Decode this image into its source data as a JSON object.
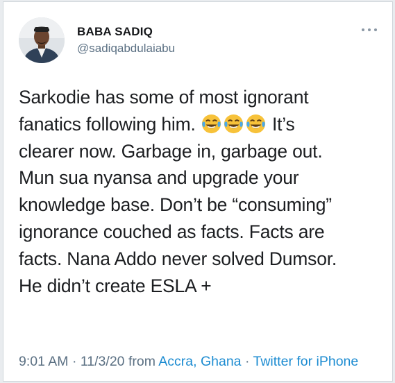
{
  "tweet": {
    "author": {
      "name": "BABA SADIQ",
      "handle": "@sadiqabdulaiabu"
    },
    "body": {
      "line1": "Sarkodie has some of most ignorant",
      "line2_before": "fanatics following him.",
      "line2_after": "It’s",
      "line3": "clearer now. Garbage in, garbage out.",
      "line4": "Mun sua nyansa and upgrade your",
      "line5": "knowledge base. Don’t be “consuming”",
      "line6": "ignorance couched as facts. Facts are",
      "line7": "facts. Nana Addo never solved Dumsor.",
      "line8": "He didn’t create ESLA +",
      "emojis": [
        "face-with-tears-of-joy",
        "face-with-tears-of-joy",
        "face-with-tears-of-joy"
      ]
    },
    "meta": {
      "time": "9:01 AM",
      "separator": "·",
      "date": "11/3/20",
      "from_label": "from",
      "location": "Accra, Ghana",
      "client": "Twitter for iPhone"
    }
  },
  "colors": {
    "name_text": "#141619",
    "secondary_text": "#5b7083",
    "link": "#1b8bd1",
    "emoji_face": "#f7c23a",
    "emoji_tears": "#4aa8e8"
  }
}
